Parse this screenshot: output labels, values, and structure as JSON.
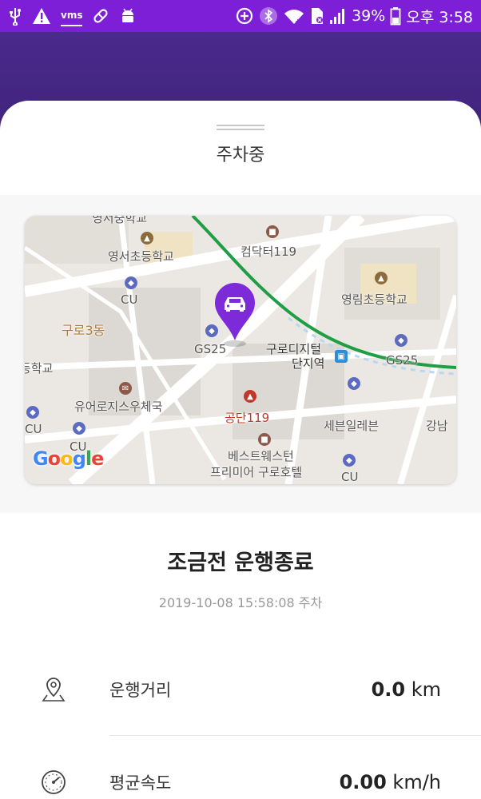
{
  "status_bar": {
    "vms": "vms",
    "battery_percent": "39%",
    "time": "오후 3:58"
  },
  "sheet": {
    "title": "주차중"
  },
  "map": {
    "labels": {
      "school_top": "영서중학교",
      "yeongseo_elem": "영서초등학교",
      "cu_1": "CU",
      "guro3dong": "구로3동",
      "gs25_1": "GS25",
      "deungschool": "등학교",
      "post_office": "유어로지스우체국",
      "cu_2": "CU",
      "cu_3": "CU",
      "gongdan119": "공단119",
      "best_western": "베스트웨스턴",
      "premier_hotel": "프리미어 구로호텔",
      "computer119": "컴닥터119",
      "yeongrim_elem": "영림초등학교",
      "guro_station1": "구로디지털",
      "guro_station2": "단지역",
      "gs25_2": "GS25",
      "seven_eleven": "세븐일레븐",
      "gangnam": "강남",
      "cu_4": "CU"
    },
    "google": "Google"
  },
  "trip": {
    "status": "조금전 운행종료",
    "parked_at": "2019-10-08 15:58:08 주차"
  },
  "stats": {
    "distance_label": "운행거리",
    "distance_value": "0.0",
    "distance_unit": "km",
    "speed_label": "평균속도",
    "speed_value": "0.00",
    "speed_unit": "km/h"
  },
  "colors": {
    "status_bar": "#7d1fd6",
    "header": "#4a2a8c",
    "pin": "#7d2bd9",
    "subway_line": "#1f9e45"
  }
}
